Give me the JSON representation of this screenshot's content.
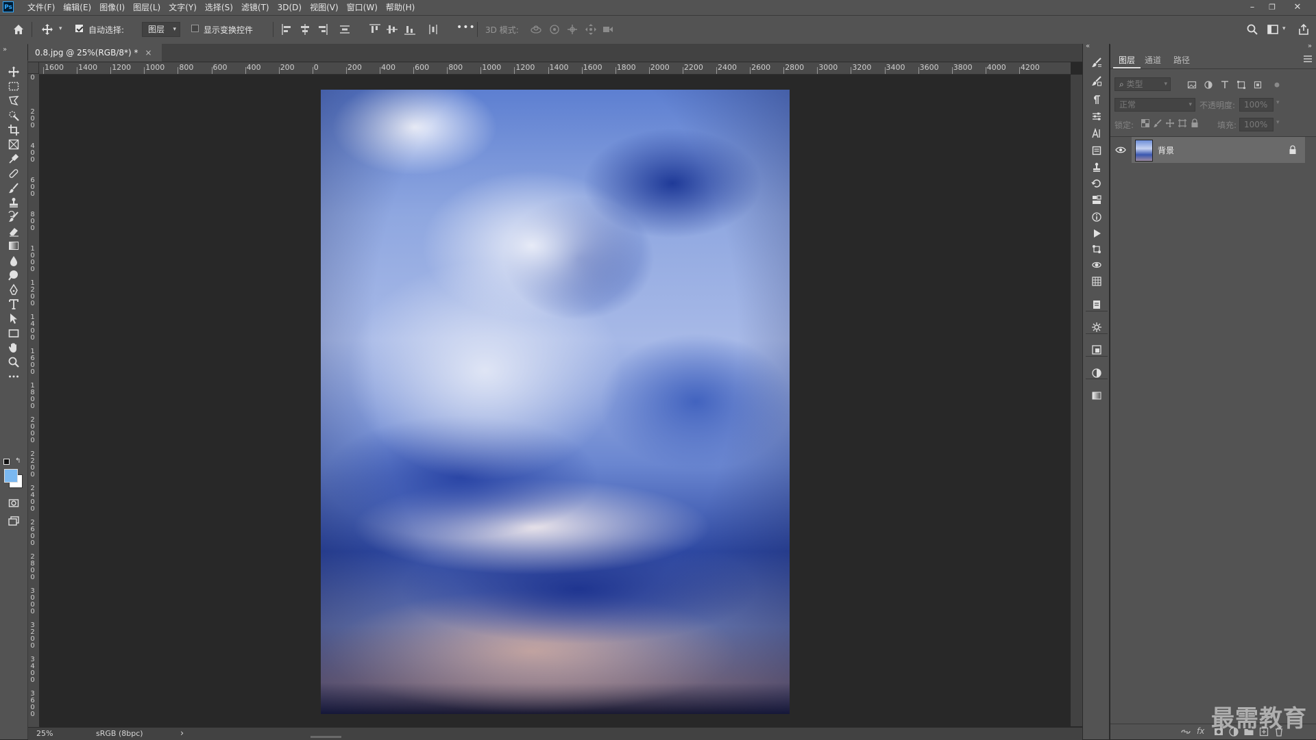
{
  "app": {
    "logo": "Ps"
  },
  "menu": [
    "文件(F)",
    "编辑(E)",
    "图像(I)",
    "图层(L)",
    "文字(Y)",
    "选择(S)",
    "滤镜(T)",
    "3D(D)",
    "视图(V)",
    "窗口(W)",
    "帮助(H)"
  ],
  "window_controls": {
    "minimize": "–",
    "restore": "❐",
    "close": "✕"
  },
  "options": {
    "auto_select_checked": true,
    "auto_select_label": "自动选择:",
    "target_value": "图层",
    "show_transform_checked": false,
    "show_transform_label": "显示变换控件",
    "more": "•••",
    "mode_3d_label": "3D 模式:"
  },
  "document": {
    "tab_title": "0.8.jpg @ 25%(RGB/8*) *",
    "tab_close": "×",
    "zoom": "25%",
    "color_profile": "sRGB (8bpc)",
    "status_arrow": "›"
  },
  "ruler": {
    "horizontal": [
      "1600",
      "1400",
      "1200",
      "1000",
      "800",
      "600",
      "400",
      "200",
      "0",
      "200",
      "400",
      "600",
      "800",
      "1000",
      "1200",
      "1400",
      "1600",
      "1800",
      "2000",
      "2200",
      "2400",
      "2600",
      "2800",
      "3000",
      "3200",
      "3400",
      "3600",
      "3800",
      "4000",
      "4200"
    ],
    "vertical": [
      "0",
      "200",
      "400",
      "600",
      "800",
      "1000",
      "1200",
      "1400",
      "1600",
      "1800",
      "2000",
      "2200",
      "2400",
      "2600",
      "2800",
      "3000",
      "3200",
      "3400",
      "3600"
    ]
  },
  "layers_panel": {
    "tabs": [
      "图层",
      "通道",
      "路径"
    ],
    "active_tab": "图层",
    "filter_kind": "类型",
    "blend_mode": "正常",
    "opacity_label": "不透明度:",
    "opacity_value": "100%",
    "lock_label": "锁定:",
    "fill_label": "填充:",
    "fill_value": "100%",
    "layers": [
      {
        "name": "背景",
        "visible": true,
        "locked": true
      }
    ],
    "bottom_fx": "fx"
  },
  "watermark": "最需教育"
}
